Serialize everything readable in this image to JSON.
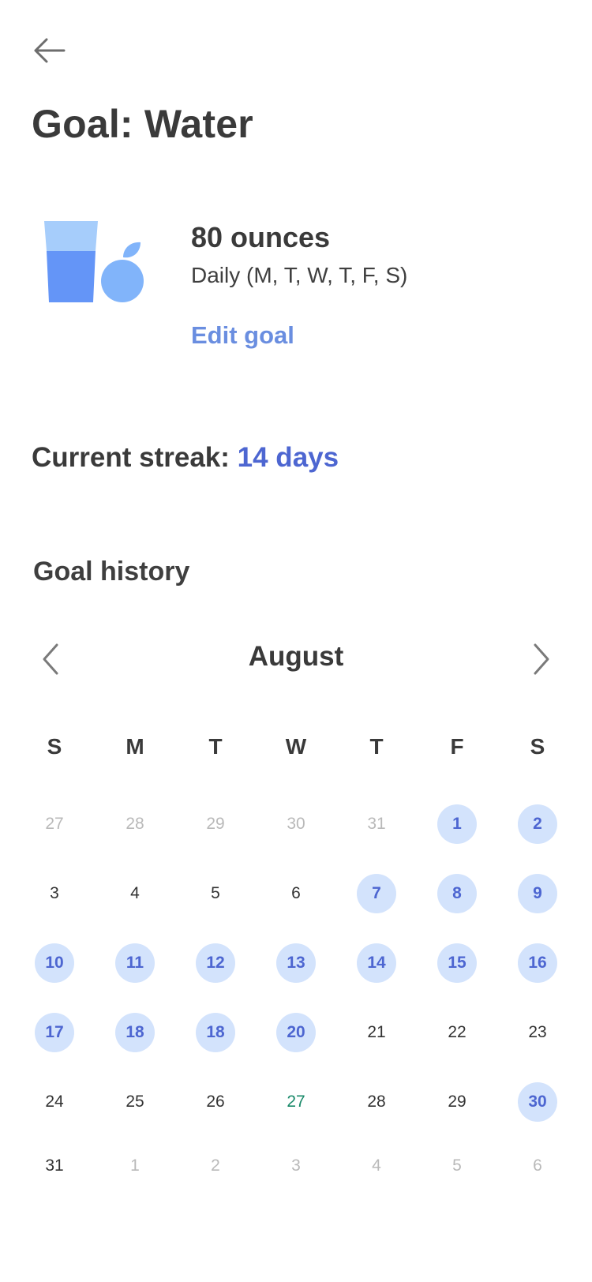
{
  "header": {
    "back_icon": "arrow-left-icon",
    "title": "Goal: Water"
  },
  "goal": {
    "illustration": "water-glass-and-apple-icon",
    "amount": "80 ounces",
    "schedule": "Daily (M, T, W, T, F, S)",
    "edit_label": "Edit goal"
  },
  "streak": {
    "label": "Current streak:",
    "value": "14 days"
  },
  "history": {
    "title": "Goal history",
    "month": "August",
    "prev_icon": "chevron-left-icon",
    "next_icon": "chevron-right-icon",
    "weekdays": [
      "S",
      "M",
      "T",
      "W",
      "T",
      "F",
      "S"
    ],
    "weeks": [
      [
        {
          "day": "27",
          "state": "other"
        },
        {
          "day": "28",
          "state": "other"
        },
        {
          "day": "29",
          "state": "other"
        },
        {
          "day": "30",
          "state": "other"
        },
        {
          "day": "31",
          "state": "other"
        },
        {
          "day": "1",
          "state": "done"
        },
        {
          "day": "2",
          "state": "done"
        }
      ],
      [
        {
          "day": "3",
          "state": "normal"
        },
        {
          "day": "4",
          "state": "normal"
        },
        {
          "day": "5",
          "state": "normal"
        },
        {
          "day": "6",
          "state": "normal"
        },
        {
          "day": "7",
          "state": "done"
        },
        {
          "day": "8",
          "state": "done"
        },
        {
          "day": "9",
          "state": "done"
        }
      ],
      [
        {
          "day": "10",
          "state": "done"
        },
        {
          "day": "11",
          "state": "done"
        },
        {
          "day": "12",
          "state": "done"
        },
        {
          "day": "13",
          "state": "done"
        },
        {
          "day": "14",
          "state": "done"
        },
        {
          "day": "15",
          "state": "done"
        },
        {
          "day": "16",
          "state": "done"
        }
      ],
      [
        {
          "day": "17",
          "state": "done"
        },
        {
          "day": "18",
          "state": "done"
        },
        {
          "day": "18",
          "state": "done"
        },
        {
          "day": "20",
          "state": "done"
        },
        {
          "day": "21",
          "state": "normal"
        },
        {
          "day": "22",
          "state": "normal"
        },
        {
          "day": "23",
          "state": "normal"
        }
      ],
      [
        {
          "day": "24",
          "state": "normal"
        },
        {
          "day": "25",
          "state": "normal"
        },
        {
          "day": "26",
          "state": "normal"
        },
        {
          "day": "27",
          "state": "today"
        },
        {
          "day": "28",
          "state": "normal"
        },
        {
          "day": "29",
          "state": "normal"
        },
        {
          "day": "30",
          "state": "done"
        }
      ],
      [
        {
          "day": "31",
          "state": "normal"
        },
        {
          "day": "1",
          "state": "other"
        },
        {
          "day": "2",
          "state": "other"
        },
        {
          "day": "3",
          "state": "other"
        },
        {
          "day": "4",
          "state": "other"
        },
        {
          "day": "5",
          "state": "other"
        },
        {
          "day": "6",
          "state": "other"
        }
      ]
    ]
  },
  "colors": {
    "accent": "#4d66d1",
    "link": "#6a8ee0",
    "completed_bg": "#d3e3fc",
    "today": "#1a8a6a",
    "glass_light": "#a6cdfb",
    "glass_dark": "#6495f7",
    "apple": "#81b4fa"
  }
}
